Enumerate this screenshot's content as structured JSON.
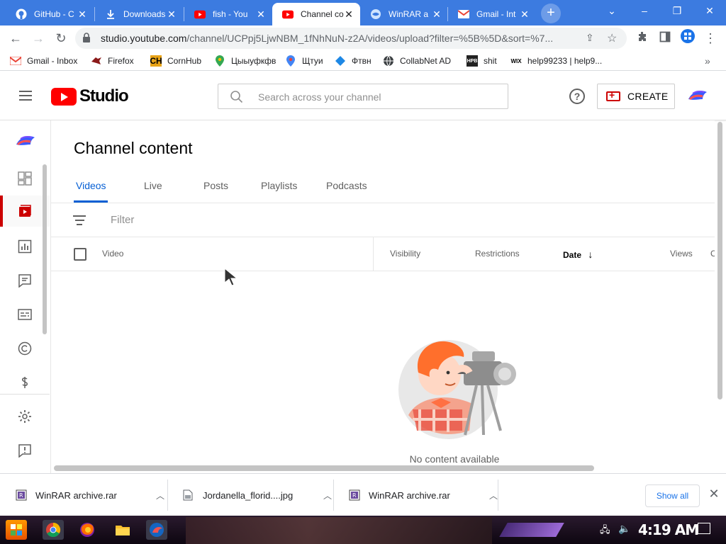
{
  "browser": {
    "tabs": [
      {
        "title": "GitHub - C",
        "icon": "github-icon"
      },
      {
        "title": "Downloads",
        "icon": "download-icon"
      },
      {
        "title": "fish - You",
        "icon": "youtube-icon"
      },
      {
        "title": "Channel co",
        "icon": "youtube-studio-icon",
        "active": true
      },
      {
        "title": "WinRAR a",
        "icon": "winrar-icon"
      },
      {
        "title": "Gmail - Int",
        "icon": "gmail-icon"
      }
    ],
    "url_domain": "studio.youtube.com",
    "url_rest": "/channel/UCPpj5LjwNBM_1fNhNuN-z2A/videos/upload?filter=%5B%5D&sort=%7...",
    "bookmarks": [
      {
        "label": "Gmail - Inbox",
        "icon": "gmail-icon"
      },
      {
        "label": "Firefox",
        "icon": "firefox-bookmark-icon"
      },
      {
        "label": "CornHub",
        "icon": "cornhub-icon"
      },
      {
        "label": "Цыыуфкфв",
        "icon": "maps-pin-icon"
      },
      {
        "label": "Щтуи",
        "icon": "maps-pin-icon"
      },
      {
        "label": "Фтвн",
        "icon": "diamond-icon"
      },
      {
        "label": "CollabNet AD",
        "icon": "globe-icon"
      },
      {
        "label": "shit",
        "icon": "hpb-icon"
      },
      {
        "label": "help99233 | help9...",
        "icon": "wix-icon"
      }
    ],
    "bookmarks_overflow": "»"
  },
  "studio": {
    "logo_text": "Studio",
    "search_placeholder": "Search across your channel",
    "help_label": "?",
    "create_label": "CREATE",
    "page_title": "Channel content",
    "tabs": [
      "Videos",
      "Live",
      "Posts",
      "Playlists",
      "Podcasts"
    ],
    "active_tab": "Videos",
    "filter_placeholder": "Filter",
    "columns": {
      "video": "Video",
      "visibility": "Visibility",
      "restrictions": "Restrictions",
      "date": "Date",
      "date_sort": "↓",
      "views": "Views",
      "comments": "C"
    },
    "empty_message": "No content available"
  },
  "downloads": {
    "items": [
      {
        "name": "WinRAR archive.rar",
        "icon": "winrar-file-icon"
      },
      {
        "name": "Jordanella_florid....jpg",
        "icon": "image-file-icon"
      },
      {
        "name": "WinRAR archive.rar",
        "icon": "winrar-file-icon"
      }
    ],
    "show_all": "Show all",
    "close": "✕"
  },
  "taskbar": {
    "clock": "4:19 AM"
  },
  "colors": {
    "tabbar": "#3c7be0",
    "accent_blue": "#065fd4",
    "youtube_red": "#ff0000",
    "studio_red": "#cc0000"
  }
}
